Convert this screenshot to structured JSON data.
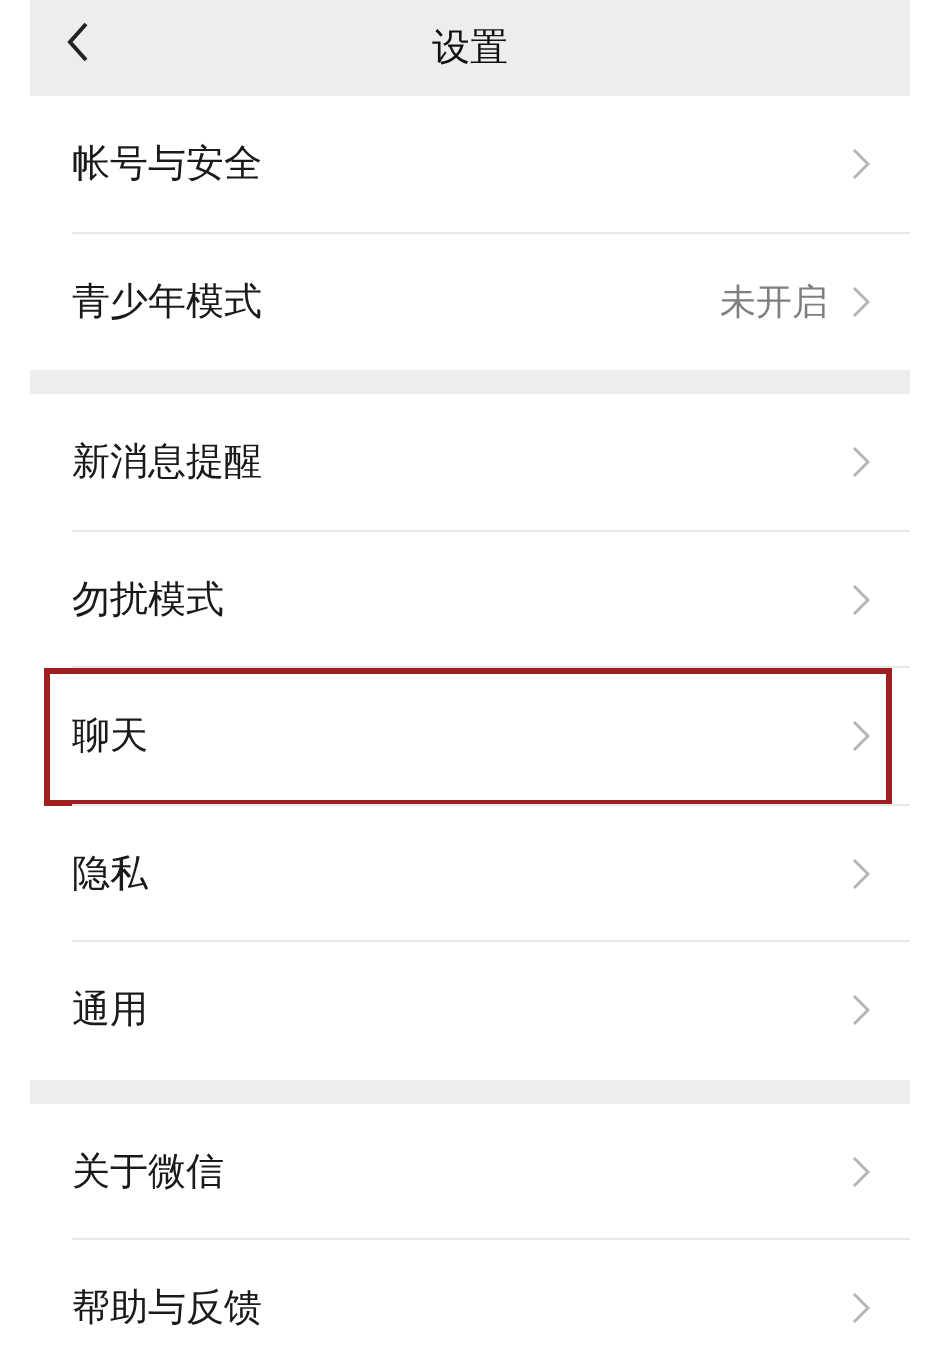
{
  "header": {
    "title": "设置"
  },
  "sections": [
    {
      "items": [
        {
          "label": "帐号与安全",
          "highlighted": false
        },
        {
          "label": "青少年模式",
          "value": "未开启",
          "highlighted": false
        }
      ]
    },
    {
      "items": [
        {
          "label": "新消息提醒",
          "highlighted": false
        },
        {
          "label": "勿扰模式",
          "highlighted": false
        },
        {
          "label": "聊天",
          "highlighted": true
        },
        {
          "label": "隐私",
          "highlighted": false
        },
        {
          "label": "通用",
          "highlighted": false
        }
      ]
    },
    {
      "items": [
        {
          "label": "关于微信",
          "highlighted": false
        },
        {
          "label": "帮助与反馈",
          "highlighted": false
        }
      ]
    }
  ]
}
